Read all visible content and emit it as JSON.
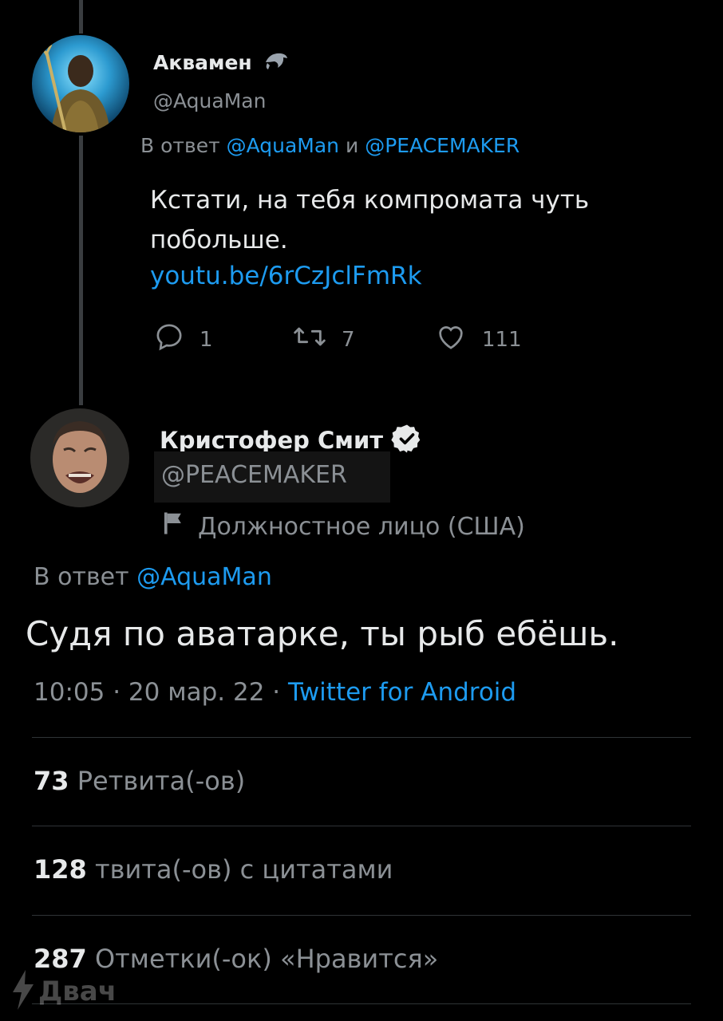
{
  "tweet1": {
    "name": "Аквамен",
    "handle": "@AquaMan",
    "reply_prefix": "В ответ",
    "reply_user1": "@AquaMan",
    "reply_and": "и",
    "reply_user2": "@PEACEMAKER",
    "text": "Кстати, на тебя компромата чуть побольше.",
    "link": "youtu.be/6rCzJclFmRk",
    "replies": "1",
    "retweets": "7",
    "likes": "111"
  },
  "tweet2": {
    "name": "Кристофер Смит",
    "handle": "@PEACEMAKER",
    "label": "Должностное лицо (США)",
    "reply_prefix": "В ответ",
    "reply_user": "@AquaMan",
    "text": "Судя по аватарке, ты рыб ебёшь.",
    "time": "10:05",
    "sep": "·",
    "date": "20 мар. 22",
    "source": "Twitter for Android"
  },
  "stats": {
    "retweets_count": "73",
    "retweets_label": "Ретвита(-ов)",
    "quotes_count": "128",
    "quotes_label": "твита(-ов) с цитатами",
    "likes_count": "287",
    "likes_label": "Отметки(-ок) «Нравится»"
  },
  "watermark": "Двач",
  "colors": {
    "link": "#1d9bf0",
    "background": "#000000",
    "verified": "#e7e9ea"
  }
}
